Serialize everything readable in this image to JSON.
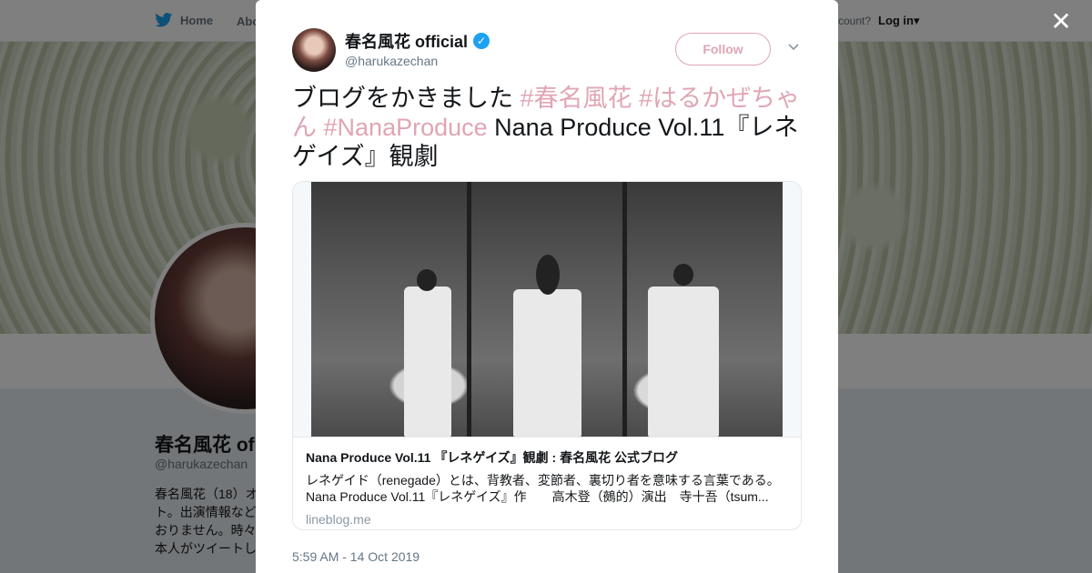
{
  "background": {
    "nav": {
      "home": "Home",
      "about": "Abo",
      "account_prompt": "ccount?",
      "login": "Log in"
    },
    "profile": {
      "name": "春名風花 of",
      "handle": "@harukazechan",
      "bio": "春名風花（18）オ ト。出演情報など おりません。時々 本人がツイートし"
    }
  },
  "modal": {
    "close_icon": "close-icon",
    "author": {
      "name": "春名風花 official",
      "handle": "@harukazechan",
      "verified_icon": "verified-badge-icon"
    },
    "follow_label": "Follow",
    "tweet": {
      "text_plain_1": "ブログをかきました ",
      "tag_1": "#春名風花",
      "tag_2": "#はるかぜちゃん",
      "tag_3": "#NanaProduce",
      "text_plain_2": " Nana Produce Vol.11『レネゲイズ』観劇"
    },
    "link_card": {
      "title": "Nana Produce Vol.11 『レネゲイズ』観劇 : 春名風花 公式ブログ",
      "description": "レネゲイド（renegade）とは、背教者、変節者、裏切り者を意味する言葉である。 Nana Produce Vol.11『レネゲイズ』作　　高木登（鵺的）演出　寺十吾（tsum...",
      "domain": "lineblog.me"
    },
    "timestamp": "5:59 AM - 14 Oct 2019"
  },
  "colors": {
    "accent_pink": "#e0a5b4",
    "twitter_blue": "#1da1f2",
    "text_dark": "#14171a",
    "text_gray": "#657786"
  }
}
